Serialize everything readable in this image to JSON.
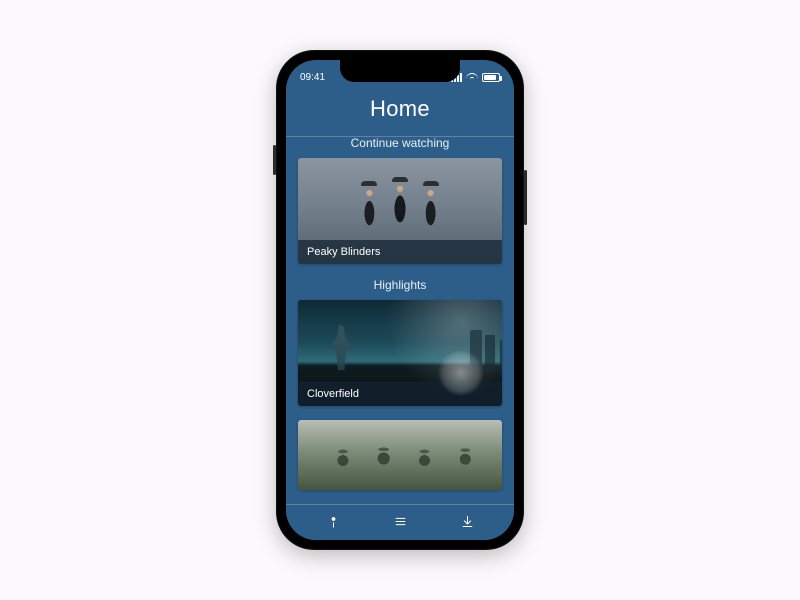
{
  "status": {
    "time": "09:41"
  },
  "header": {
    "title": "Home"
  },
  "sections": {
    "continue": {
      "title": "Continue watching",
      "item": {
        "title": "Peaky Blinders"
      }
    },
    "highlights": {
      "title": "Highlights",
      "items": [
        {
          "title": "Cloverfield"
        }
      ]
    }
  },
  "nav": {
    "home": "home-icon",
    "menu": "menu-icon",
    "downloads": "download-icon"
  }
}
